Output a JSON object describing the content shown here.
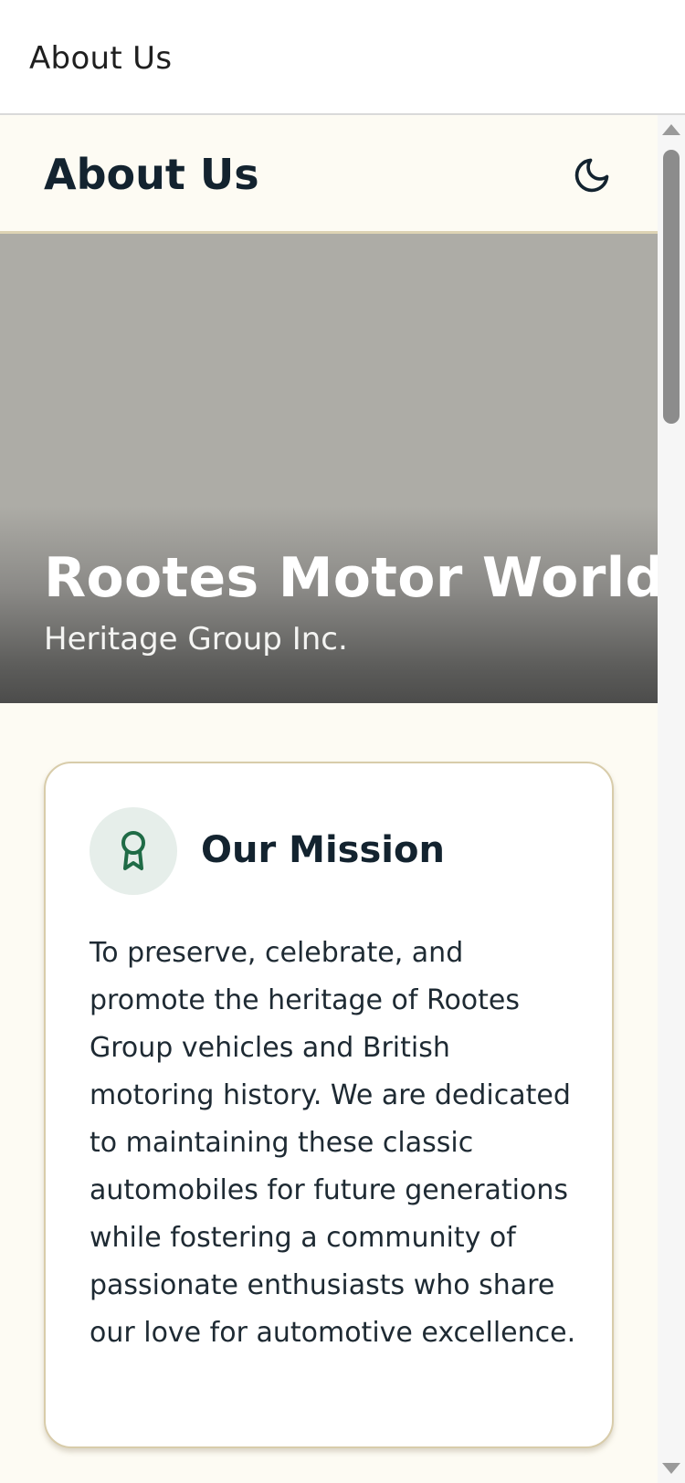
{
  "window": {
    "title": "About Us"
  },
  "header": {
    "title": "About Us",
    "theme_toggle_icon": "moon-icon"
  },
  "hero": {
    "title": "Rootes Motor World",
    "subtitle": "Heritage Group Inc."
  },
  "mission": {
    "icon": "award-ribbon-icon",
    "heading": "Our Mission",
    "text": "To preserve, celebrate, and promote the heritage of Rootes Group vehicles and British motoring history. We are dedicated to maintaining these classic automobiles for future generations while fostering a community of passionate enthusiasts who share our love for automotive excellence."
  },
  "colors": {
    "background": "#fdfbf3",
    "heading_text": "#13232f",
    "accent_green": "#1f6b46",
    "card_border": "#d8ccaa"
  }
}
